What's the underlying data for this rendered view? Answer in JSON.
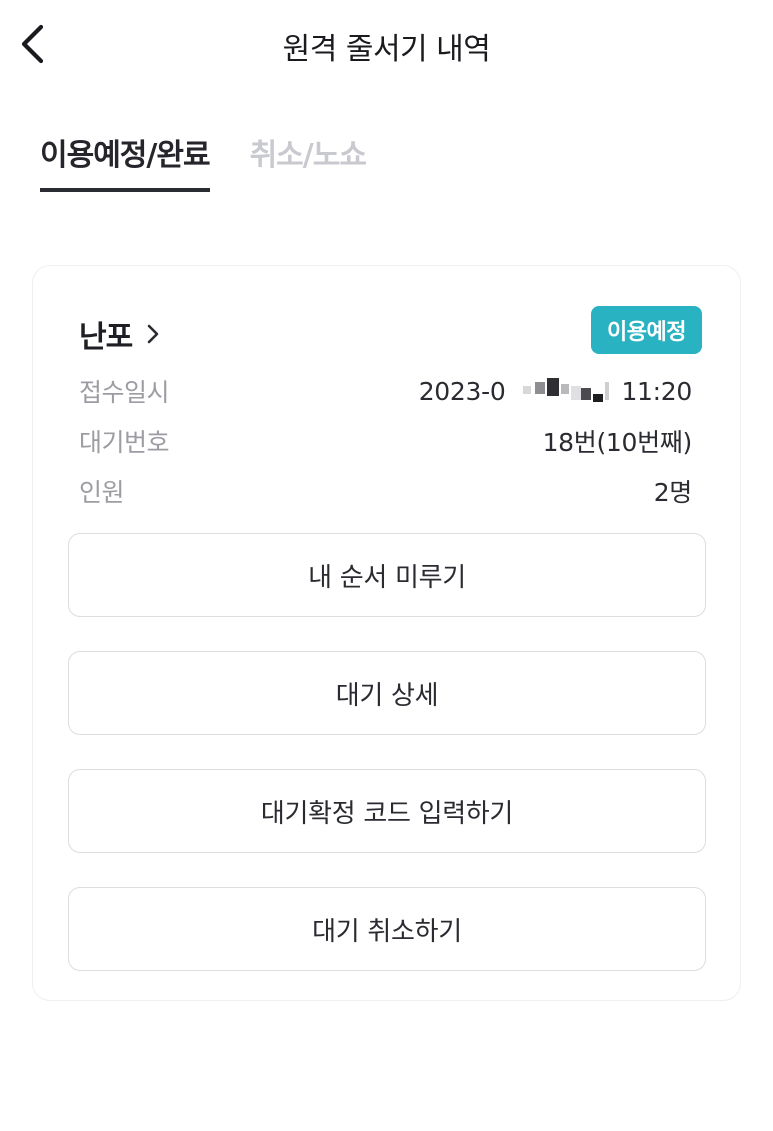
{
  "header": {
    "title": "원격 줄서기 내역"
  },
  "tabs": [
    {
      "label": "이용예정/완료",
      "active": true
    },
    {
      "label": "취소/노쇼",
      "active": false
    }
  ],
  "reservation": {
    "store_name": "난포",
    "status_badge": "이용예정",
    "status_color": "#29b2c2",
    "rows": {
      "received_label": "접수일시",
      "received_date": "2023-0",
      "received_time": "11:20",
      "queue_label": "대기번호",
      "queue_value": "18번(10번째)",
      "people_label": "인원",
      "people_value": "2명"
    },
    "buttons": {
      "postpone": "내 순서 미루기",
      "detail": "대기 상세",
      "confirm_code": "대기확정 코드 입력하기",
      "cancel": "대기 취소하기"
    }
  }
}
